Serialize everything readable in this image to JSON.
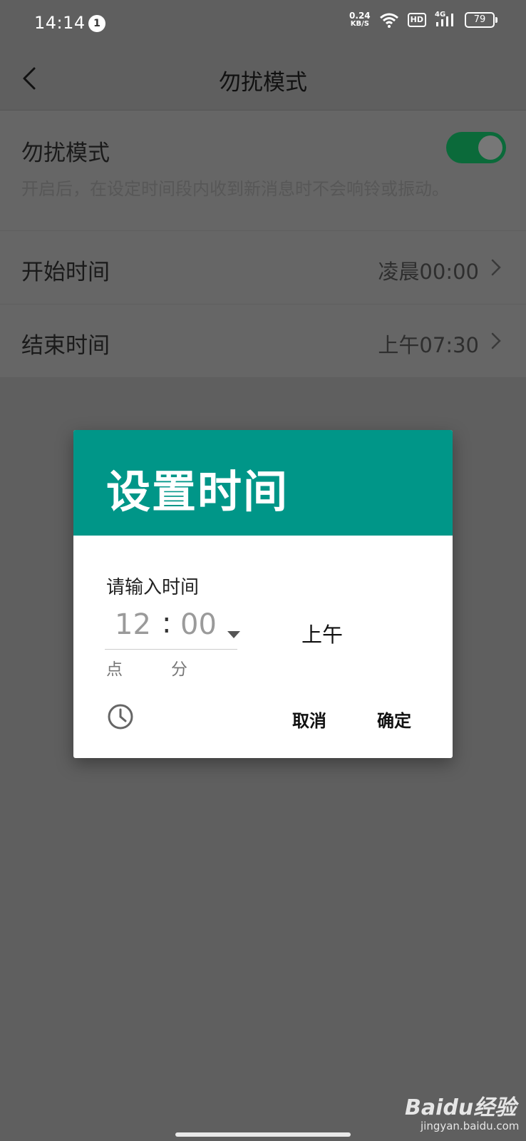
{
  "status_bar": {
    "time": "14:14",
    "notification_count": "1",
    "net_speed_value": "0.24",
    "net_speed_unit": "KB/S",
    "hd_label": "HD",
    "signal_label": "4G",
    "battery": "79"
  },
  "header": {
    "title": "勿扰模式"
  },
  "settings": {
    "dnd_title": "勿扰模式",
    "dnd_description": "开启后，在设定时间段内收到新消息时不会响铃或振动。",
    "dnd_enabled": true,
    "start_label": "开始时间",
    "start_value": "凌晨00:00",
    "end_label": "结束时间",
    "end_value": "上午07:30"
  },
  "dialog": {
    "title": "设置时间",
    "input_label": "请输入时间",
    "hour": "12",
    "separator": ":",
    "minute": "00",
    "hour_unit": "点",
    "minute_unit": "分",
    "ampm": "上午",
    "cancel_label": "取消",
    "ok_label": "确定"
  },
  "watermark": {
    "logo": "Baidu经验",
    "url": "jingyan.baidu.com"
  },
  "colors": {
    "accent": "#009688",
    "toggle_on": "#0b6a3a",
    "scrim": "#5f5f5f"
  }
}
